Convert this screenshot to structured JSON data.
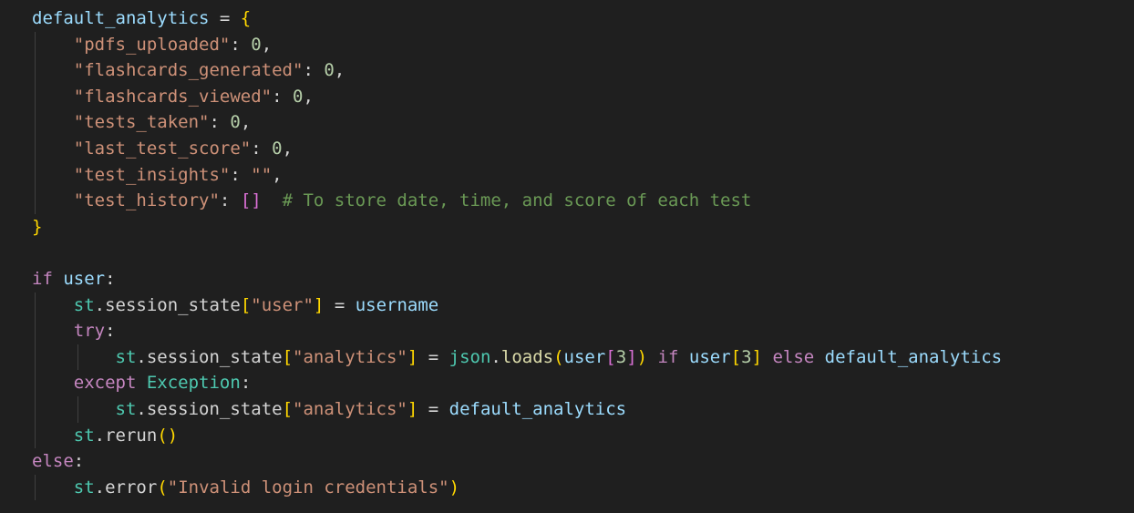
{
  "code": {
    "l1": {
      "name": "default_analytics",
      "eq": " = ",
      "open": "{"
    },
    "l2": {
      "key": "\"pdfs_uploaded\"",
      "colon": ": ",
      "val": "0",
      "comma": ","
    },
    "l3": {
      "key": "\"flashcards_generated\"",
      "colon": ": ",
      "val": "0",
      "comma": ","
    },
    "l4": {
      "key": "\"flashcards_viewed\"",
      "colon": ": ",
      "val": "0",
      "comma": ","
    },
    "l5": {
      "key": "\"tests_taken\"",
      "colon": ": ",
      "val": "0",
      "comma": ","
    },
    "l6": {
      "key": "\"last_test_score\"",
      "colon": ": ",
      "val": "0",
      "comma": ","
    },
    "l7": {
      "key": "\"test_insights\"",
      "colon": ": ",
      "val": "\"\"",
      "comma": ","
    },
    "l8": {
      "key": "\"test_history\"",
      "colon": ": ",
      "val": "[]",
      "comment": "  # To store date, time, and score of each test"
    },
    "l9": {
      "close": "}"
    },
    "l11": {
      "kw": "if",
      "sp": " ",
      "var": "user",
      "colon": ":"
    },
    "l12": {
      "obj": "st",
      "dot": ".",
      "attr": "session_state",
      "lb": "[",
      "key": "\"user\"",
      "rb": "]",
      "eq": " = ",
      "val": "username"
    },
    "l13": {
      "kw": "try",
      "colon": ":"
    },
    "l14": {
      "obj": "st",
      "dot": ".",
      "attr": "session_state",
      "lb": "[",
      "key": "\"analytics\"",
      "rb": "]",
      "eq": " = ",
      "mod": "json",
      "dot2": ".",
      "fn": "loads",
      "lp": "(",
      "arg": "user",
      "alb": "[",
      "idx": "3",
      "arb": "]",
      "rp": ")",
      "kw_if": " if ",
      "cond": "user",
      "clb": "[",
      "cidx": "3",
      "crb": "]",
      "kw_else": " else ",
      "alt": "default_analytics"
    },
    "l15": {
      "kw": "except",
      "sp": " ",
      "cls": "Exception",
      "colon": ":"
    },
    "l16": {
      "obj": "st",
      "dot": ".",
      "attr": "session_state",
      "lb": "[",
      "key": "\"analytics\"",
      "rb": "]",
      "eq": " = ",
      "val": "default_analytics"
    },
    "l17": {
      "obj": "st",
      "dot": ".",
      "fn": "rerun",
      "parens": "()"
    },
    "l18": {
      "kw": "else",
      "colon": ":"
    },
    "l19": {
      "obj": "st",
      "dot": ".",
      "fn": "error",
      "lp": "(",
      "str": "\"Invalid login credentials\"",
      "rp": ")"
    }
  }
}
